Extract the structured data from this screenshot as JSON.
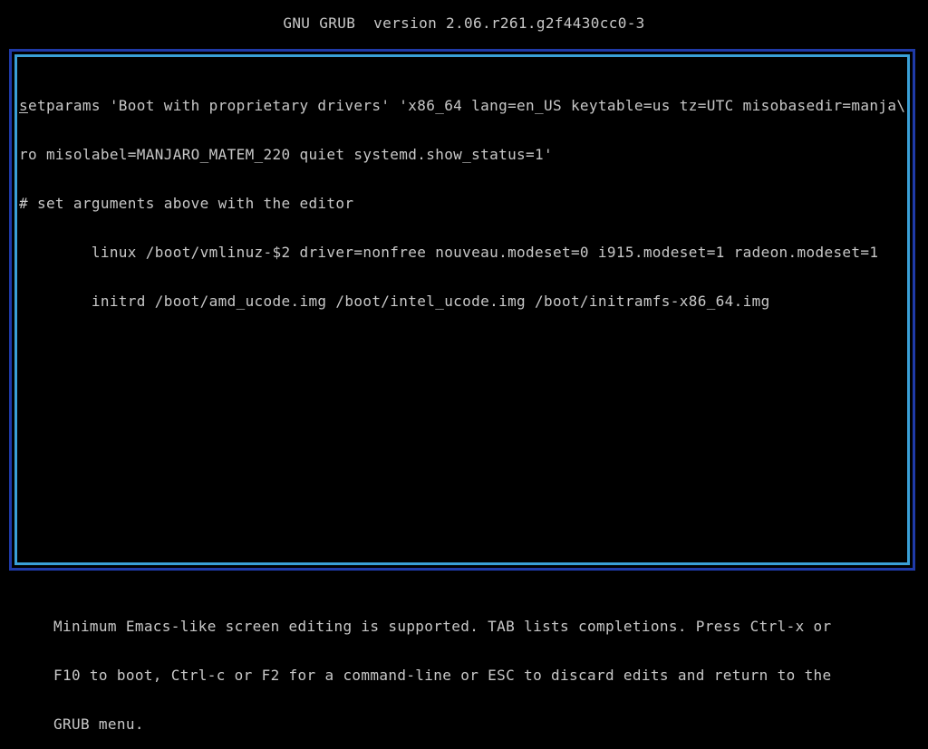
{
  "header": {
    "title": "GNU GRUB  version 2.06.r261.g2f4430cc0-3"
  },
  "editor": {
    "cursor_char": "s",
    "first_line_rest": "etparams 'Boot with proprietary drivers' 'x86_64 lang=en_US keytable=us tz=UTC misobasedir=manja\\",
    "lines": [
      "ro misolabel=MANJARO_MATEM_220 quiet systemd.show_status=1'",
      "# set arguments above with the editor",
      "        linux /boot/vmlinuz-$2 driver=nonfree nouveau.modeset=0 i915.modeset=1 radeon.modeset=1",
      "        initrd /boot/amd_ucode.img /boot/intel_ucode.img /boot/initramfs-x86_64.img"
    ]
  },
  "help": {
    "lines": [
      "Minimum Emacs-like screen editing is supported. TAB lists completions. Press Ctrl-x or",
      "F10 to boot, Ctrl-c or F2 for a command-line or ESC to discard edits and return to the",
      "GRUB menu."
    ]
  },
  "colors": {
    "background": "#000000",
    "text": "#c8c8c8",
    "frame_outer": "#1f3aa8",
    "frame_inner": "#3aa0d8"
  }
}
